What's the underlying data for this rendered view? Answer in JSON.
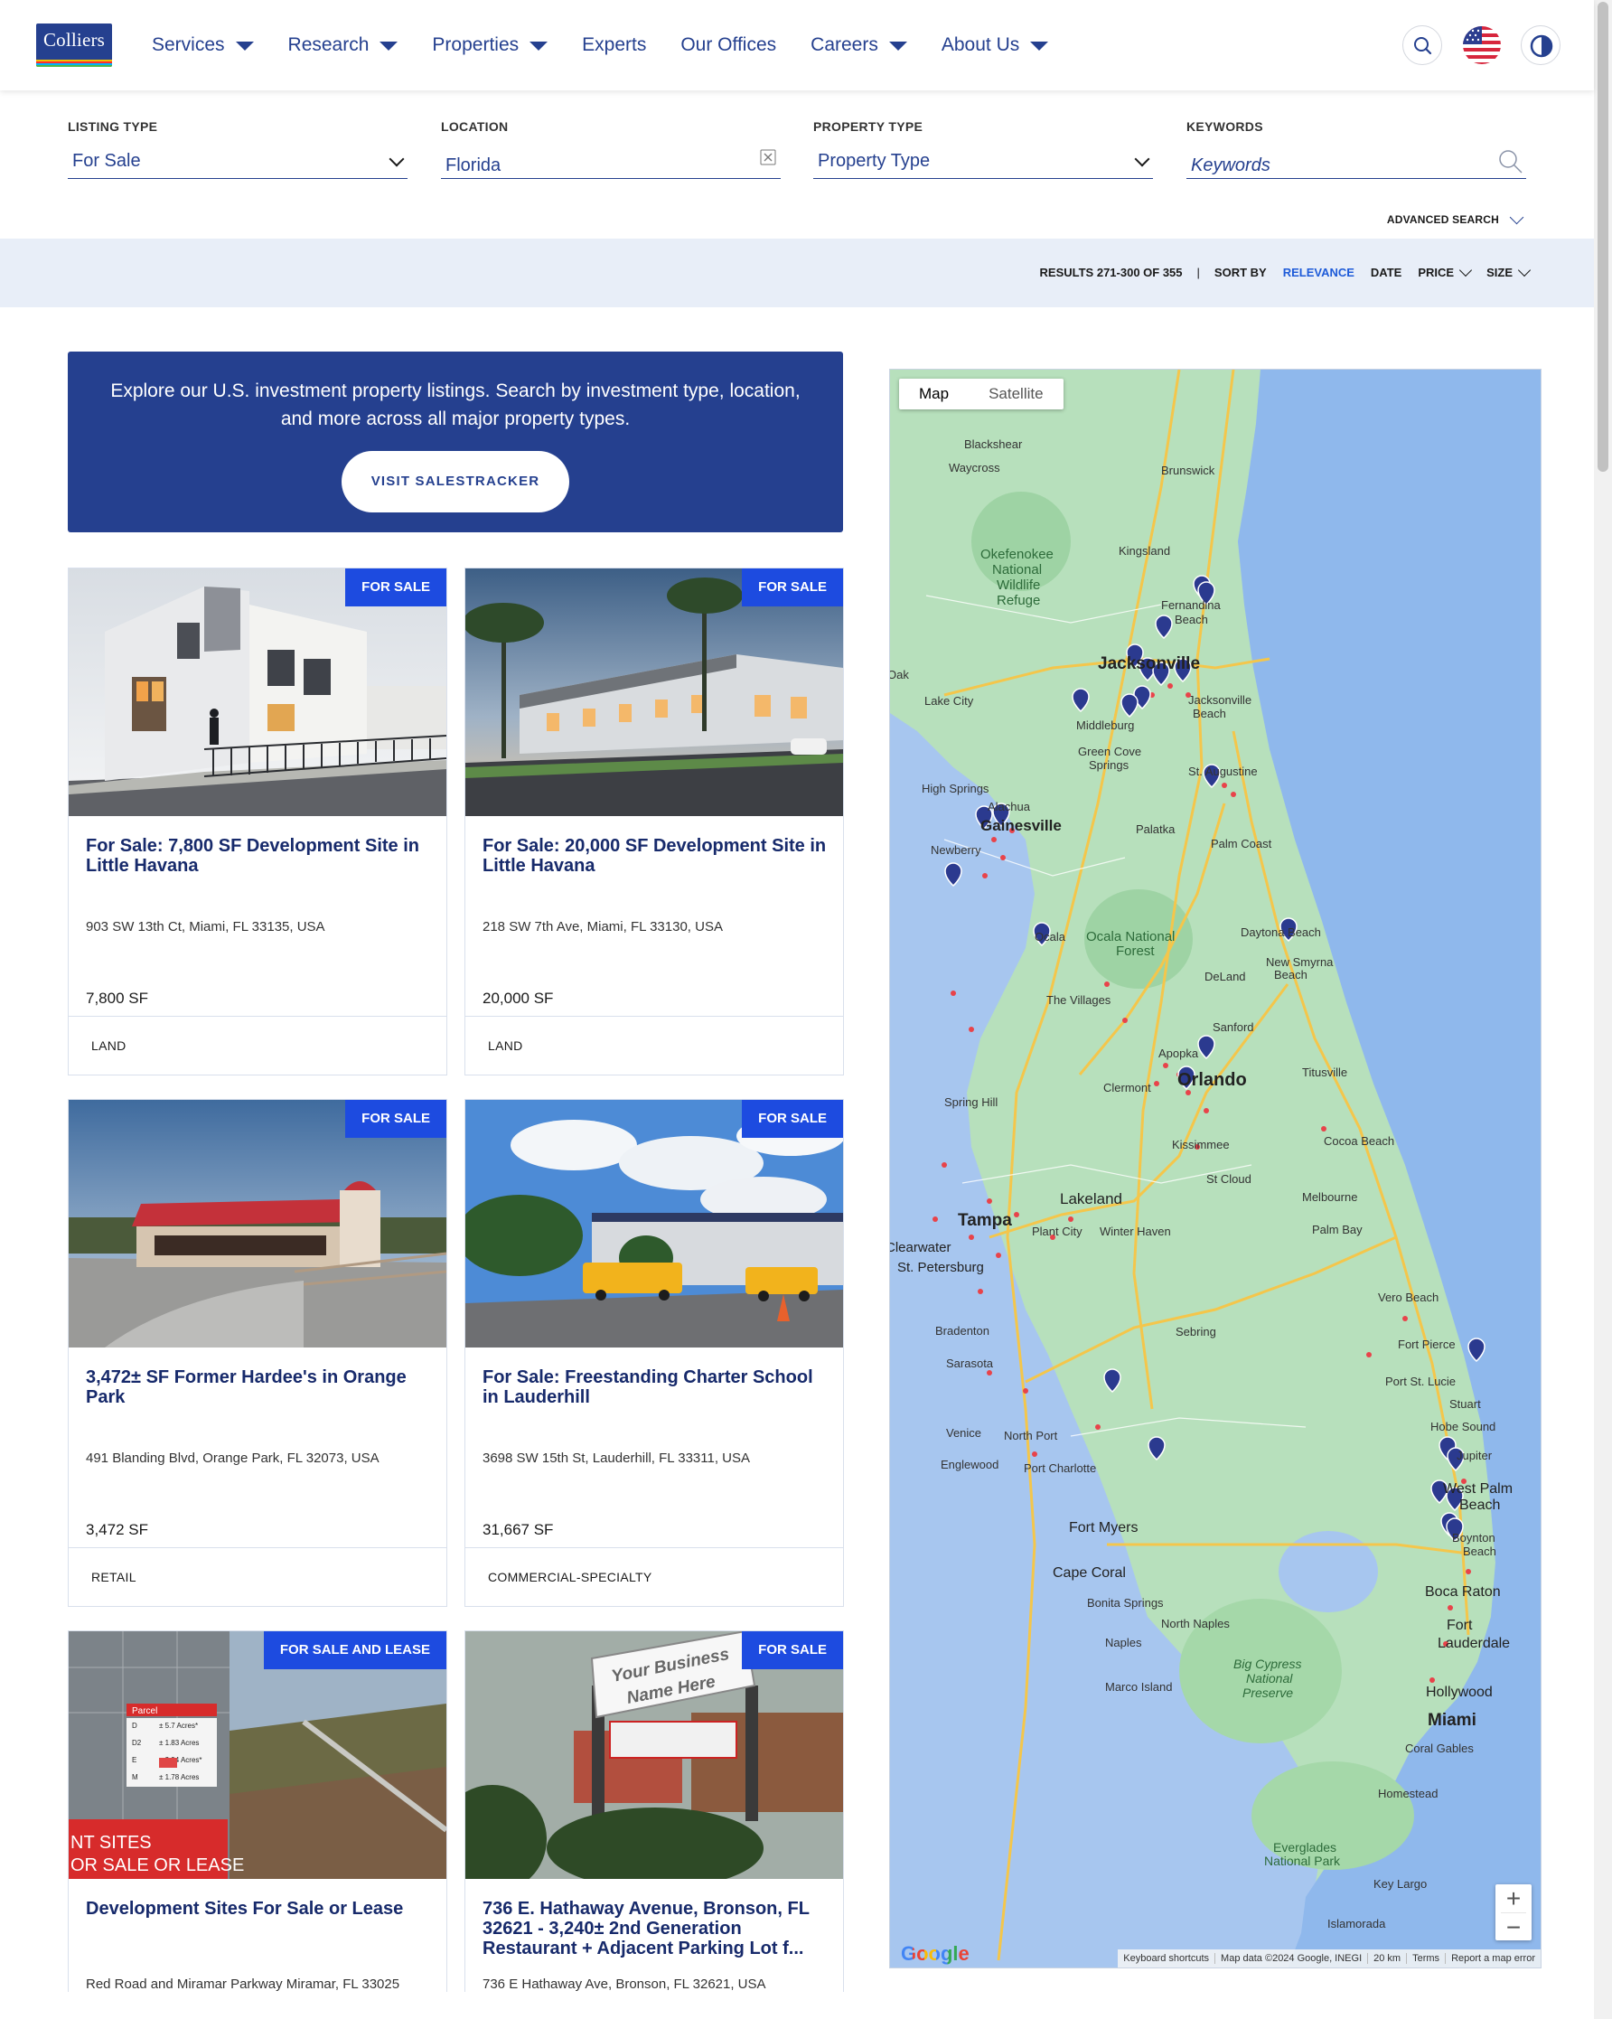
{
  "brand": {
    "logo_text": "Colliers",
    "colors": {
      "primary": "#25408f",
      "accent": "#1d4be0",
      "link": "#1e5bd8",
      "bar": "#e8eef8"
    }
  },
  "nav": {
    "items": [
      {
        "label": "Services",
        "dropdown": true
      },
      {
        "label": "Research",
        "dropdown": true
      },
      {
        "label": "Properties",
        "dropdown": true
      },
      {
        "label": "Experts",
        "dropdown": false
      },
      {
        "label": "Our Offices",
        "dropdown": false
      },
      {
        "label": "Careers",
        "dropdown": true
      },
      {
        "label": "About Us",
        "dropdown": true
      }
    ],
    "icons": [
      "search-icon",
      "us-flag-icon",
      "contrast-icon"
    ]
  },
  "filters": {
    "listing_type": {
      "label": "LISTING TYPE",
      "value": "For Sale"
    },
    "location": {
      "label": "LOCATION",
      "value": "Florida"
    },
    "property_type": {
      "label": "PROPERTY TYPE",
      "placeholder": "Property Type"
    },
    "keywords": {
      "label": "KEYWORDS",
      "placeholder": "Keywords"
    },
    "advanced": "ADVANCED SEARCH"
  },
  "results": {
    "count": "RESULTS 271-300 OF 355",
    "separator": "|",
    "sort_by": "SORT BY",
    "sort_options": [
      {
        "label": "RELEVANCE",
        "active": true,
        "chevron": false
      },
      {
        "label": "DATE",
        "active": false,
        "chevron": false
      },
      {
        "label": "PRICE",
        "active": false,
        "chevron": true
      },
      {
        "label": "SIZE",
        "active": false,
        "chevron": true
      }
    ]
  },
  "promo": {
    "text": "Explore our U.S. investment property listings. Search by investment type, location, and more across all major property types.",
    "button": "VISIT SALESTRACKER"
  },
  "listings": [
    {
      "badge": "FOR SALE",
      "title": "For Sale: 7,800 SF Development Site in Little Havana",
      "address": "903 SW 13th Ct, Miami, FL 33135, USA",
      "size": "7,800 SF",
      "type": "LAND"
    },
    {
      "badge": "FOR SALE",
      "title": "For Sale: 20,000 SF Development Site in Little Havana",
      "address": "218 SW 7th Ave, Miami, FL 33130, USA",
      "size": "20,000 SF",
      "type": "LAND"
    },
    {
      "badge": "FOR SALE",
      "title": "3,472± SF Former Hardee's in Orange Park",
      "address": "491 Blanding Blvd, Orange Park, FL 32073, USA",
      "size": "3,472 SF",
      "type": "RETAIL"
    },
    {
      "badge": "FOR SALE",
      "title": "For Sale: Freestanding Charter School in Lauderhill",
      "address": "3698 SW 15th St, Lauderhill, FL 33311, USA",
      "size": "31,667 SF",
      "type": "COMMERCIAL-SPECIALTY"
    },
    {
      "badge": "FOR SALE AND LEASE",
      "title": "Development Sites For Sale or Lease",
      "address": "Red Road and Miramar Parkway Miramar, FL 33025",
      "size": "",
      "type": ""
    },
    {
      "badge": "FOR SALE",
      "title": "736 E. Hathaway Avenue, Bronson, FL 32621 - 3,240± 2nd Generation Restaurant + Adjacent Parking Lot f...",
      "address": "736 E Hathaway Ave, Bronson, FL 32621, USA",
      "size": "",
      "type": ""
    }
  ],
  "photo_overlays": {
    "parcel_table_header": "Parcel",
    "parcel_rows": [
      {
        "id": "D",
        "acres": "± 5.7 Acres*"
      },
      {
        "id": "D2",
        "acres": "± 1.83 Acres"
      },
      {
        "id": "E",
        "acres": "± 3.94 Acres*"
      },
      {
        "id": "M",
        "acres": "± 1.78 Acres"
      }
    ],
    "parcel_banner_1": "NT SITES",
    "parcel_banner_2": "OR SALE OR LEASE",
    "sign_line_1": "Your Business",
    "sign_line_2": "Name Here"
  },
  "map": {
    "type_buttons": [
      "Map",
      "Satellite"
    ],
    "zoom_in": "+",
    "zoom_out": "−",
    "attribution": [
      "Keyboard shortcuts",
      "Map data ©2024 Google, INEGI",
      "20 km",
      "Terms",
      "Report a map error"
    ],
    "google": "Google",
    "labels": [
      "Blackshear",
      "Waycross",
      "Brunswick",
      "Okefenokee",
      "National",
      "Wildlife",
      "Refuge",
      "Kingsland",
      "Fernandina",
      "Beach",
      "Jacksonville",
      "Jacksonville",
      "Beach",
      "Lake City",
      "Middleburg",
      "Green Cove",
      "Springs",
      "St. Augustine",
      "High Springs",
      "Alachua",
      "Gainesville",
      "Newberry",
      "Palatka",
      "Palm Coast",
      "Ocala",
      "Ocala National",
      "Forest",
      "Daytona Beach",
      "New Smyrna",
      "Beach",
      "The Villages",
      "DeLand",
      "Sanford",
      "Apopka",
      "Orlando",
      "Titusville",
      "Clermont",
      "Spring Hill",
      "Kissimmee",
      "Cocoa Beach",
      "St Cloud",
      "Lakeland",
      "Tampa",
      "Melbourne",
      "Plant City",
      "Winter Haven",
      "Palm Bay",
      "Clearwater",
      "St. Petersburg",
      "Vero Beach",
      "Bradenton",
      "Sebring",
      "Fort Pierce",
      "Sarasota",
      "Port St. Lucie",
      "Stuart",
      "Venice",
      "North Port",
      "Hobe Sound",
      "Englewood",
      "Port Charlotte",
      "Jupiter",
      "West Palm",
      "Beach",
      "Fort Myers",
      "Boynton",
      "Beach",
      "Cape Coral",
      "Bonita Springs",
      "Boca Raton",
      "North Naples",
      "Naples",
      "Fort",
      "Lauderdale",
      "Big Cypress",
      "National",
      "Preserve",
      "Marco Island",
      "Hollywood",
      "Miami",
      "Coral Gables",
      "Homestead",
      "Everglades",
      "National Park",
      "Key Largo",
      "Islamorada",
      "Oak"
    ]
  }
}
